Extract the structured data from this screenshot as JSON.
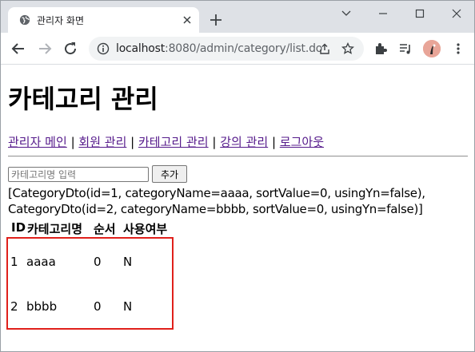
{
  "browser": {
    "tab_title": "관리자 화면",
    "url_host": "localhost",
    "url_rest": ":8080/admin/category/list.do"
  },
  "page": {
    "heading": "카테고리 관리",
    "nav": {
      "admin_main": "관리자 메인",
      "member_manage": "회원 관리",
      "category_manage": "카테고리 관리",
      "course_manage": "강의 관리",
      "logout": "로그아웃",
      "separator": "|"
    },
    "form": {
      "placeholder": "카테고리명 입력",
      "add_label": "추가"
    },
    "dto_list_text": [
      "[CategoryDto(id=1, categoryName=aaaa, sortValue=0, usingYn=false),",
      "CategoryDto(id=2, categoryName=bbbb, sortValue=0, usingYn=false)]"
    ],
    "table": {
      "headers": [
        "ID",
        "카테고리명",
        "순서",
        "사용여부"
      ],
      "rows": [
        [
          "1",
          "aaaa",
          "0",
          "N"
        ],
        [
          "2",
          "bbbb",
          "0",
          "N"
        ]
      ]
    }
  },
  "colors": {
    "link_visited": "#551a8b",
    "highlight_border": "#e0201b"
  }
}
